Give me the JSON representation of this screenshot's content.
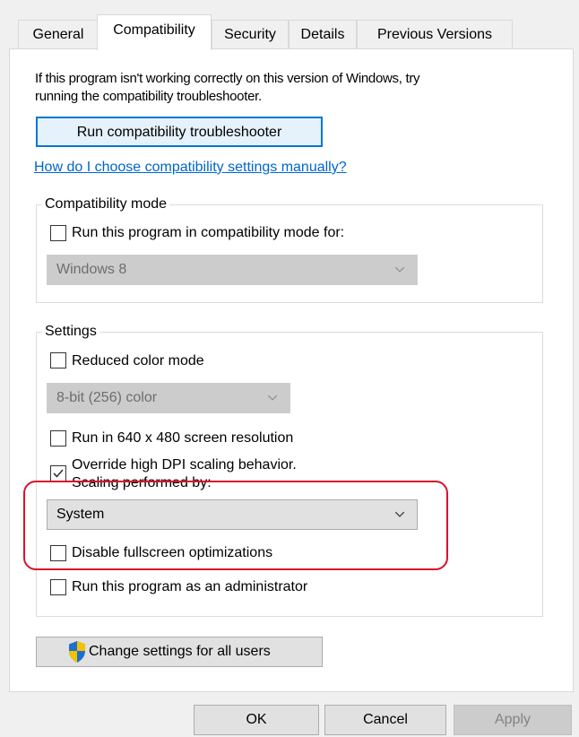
{
  "tabs": [
    {
      "label": "General"
    },
    {
      "label": "Compatibility"
    },
    {
      "label": "Security"
    },
    {
      "label": "Details"
    },
    {
      "label": "Previous Versions"
    }
  ],
  "intro_text_line1": "If this program isn't working correctly on this version of Windows, try",
  "intro_text_line2": "running the compatibility troubleshooter.",
  "troubleshooter_button": "Run compatibility troubleshooter",
  "manual_link": "How do I choose compatibility settings manually?",
  "compat_mode": {
    "group_label": "Compatibility mode",
    "checkbox_label": "Run this program in compatibility mode for:",
    "checked": false,
    "select_value": "Windows 8"
  },
  "settings": {
    "group_label": "Settings",
    "reduced_color_label": "Reduced color mode",
    "reduced_color_checked": false,
    "color_select_value": "8-bit (256) color",
    "resolution_label": "Run in 640 x 480 screen resolution",
    "resolution_checked": false,
    "dpi_label": "Override high DPI scaling behavior.",
    "dpi_checked": true,
    "scaling_label": "Scaling performed by:",
    "scaling_select_value": "System",
    "fullscreen_label": "Disable fullscreen optimizations",
    "fullscreen_checked": false,
    "admin_label": "Run this program as an administrator",
    "admin_checked": false
  },
  "change_all_users_button": "Change settings for all users",
  "footer": {
    "ok": "OK",
    "cancel": "Cancel",
    "apply": "Apply"
  },
  "colors": {
    "link": "#0066cc",
    "highlight_outline": "#d7132a",
    "button_focus_border": "#0078d7",
    "shield_blue": "#1e6fd0",
    "shield_yellow": "#f2c300"
  }
}
